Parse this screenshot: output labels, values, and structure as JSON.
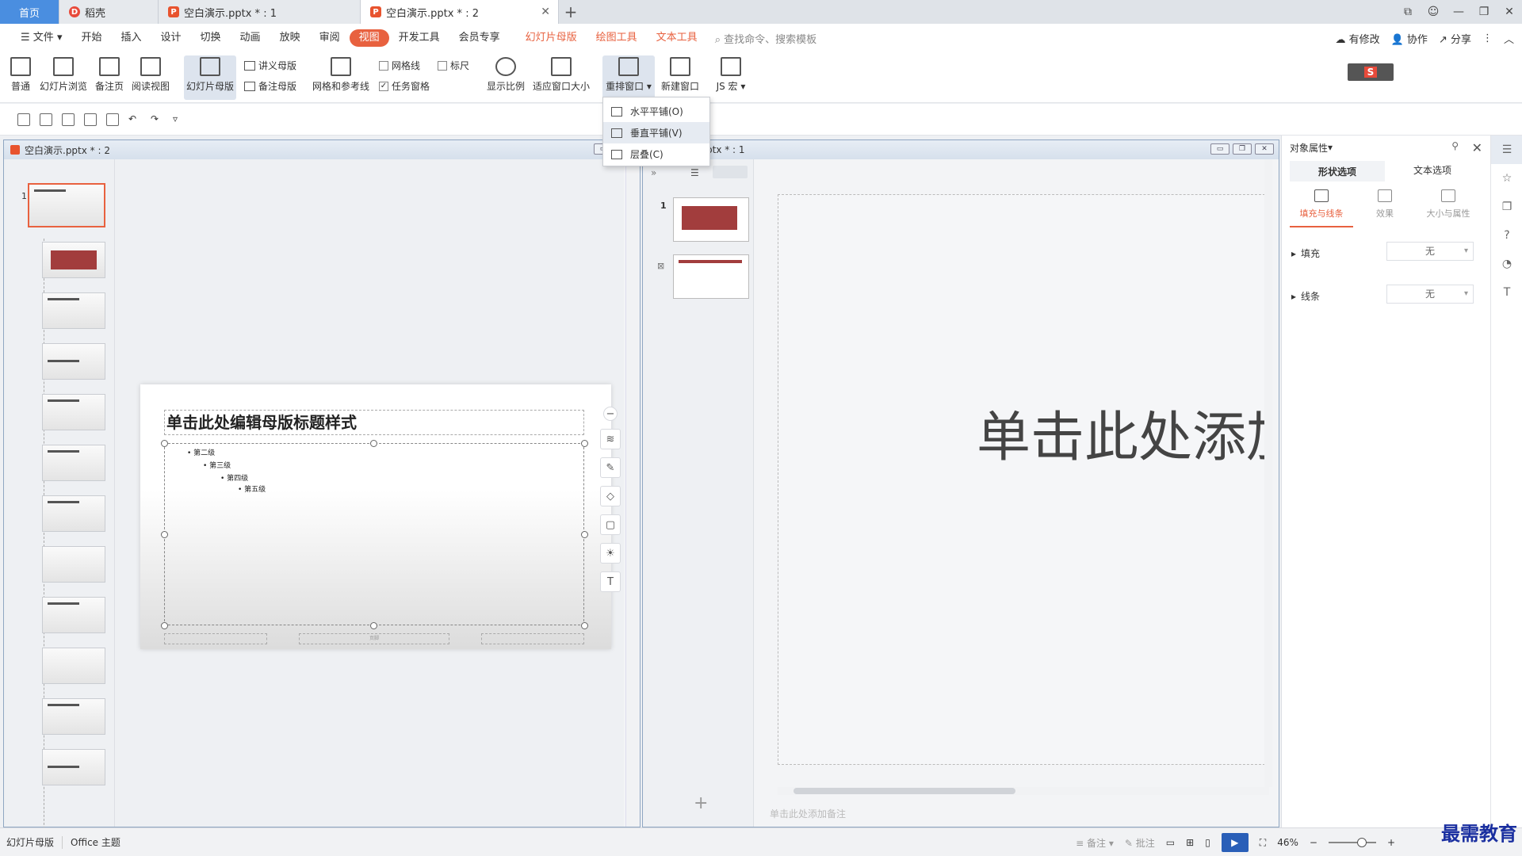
{
  "tabs": {
    "home": "首页",
    "t1": "稻壳",
    "t2": "空白演示.pptx * : 1",
    "t3": "空白演示.pptx * : 2"
  },
  "menu": {
    "file": "文件",
    "items": [
      "开始",
      "插入",
      "设计",
      "切换",
      "动画",
      "放映",
      "审阅"
    ],
    "active": "视图",
    "items2": [
      "开发工具",
      "会员专享"
    ],
    "context": [
      "幻灯片母版",
      "绘图工具",
      "文本工具"
    ],
    "search": "查找命令、搜索模板",
    "right": [
      "有修改",
      "协作",
      "分享"
    ]
  },
  "ribbon": {
    "normal": "普通",
    "sorter": "幻灯片浏览",
    "notes_page": "备注页",
    "reading": "阅读视图",
    "slide_master": "幻灯片母版",
    "handout_master": "讲义母版",
    "notes_master": "备注母版",
    "grid_guides": "网格和参考线",
    "gridlines": "网格线",
    "ruler": "标尺",
    "task_pane": "任务窗格",
    "zoom": "显示比例",
    "fit": "适应窗口大小",
    "arrange": "重排窗口",
    "new_window": "新建窗口",
    "js_macro": "JS 宏"
  },
  "dropdown": {
    "items": [
      "水平平铺(O)",
      "垂直平铺(V)",
      "层叠(C)"
    ]
  },
  "left_window": {
    "title": "空白演示.pptx * : 2",
    "slide_num": "1",
    "slide_title": "单击此处编辑母版标题样式",
    "levels": [
      "第二级",
      "第三级",
      "第四级",
      "第五级"
    ],
    "footer_center": "页脚"
  },
  "right_window": {
    "title": "ptx * : 1",
    "nums": [
      "1",
      "2"
    ],
    "big_text": "单击此处添加",
    "notes": "单击此处添加备注"
  },
  "props": {
    "title": "对象属性",
    "tab1": "形状选项",
    "tab2": "文本选项",
    "sub1": "填充与线条",
    "sub2": "效果",
    "sub3": "大小与属性",
    "fill": "填充",
    "line": "线条",
    "fill_val": "无",
    "line_val": "无"
  },
  "status": {
    "mode": "幻灯片母版",
    "theme": "Office 主题",
    "notes": "备注",
    "comment": "批注",
    "zoom": "46%"
  },
  "watermark": "最需教育"
}
